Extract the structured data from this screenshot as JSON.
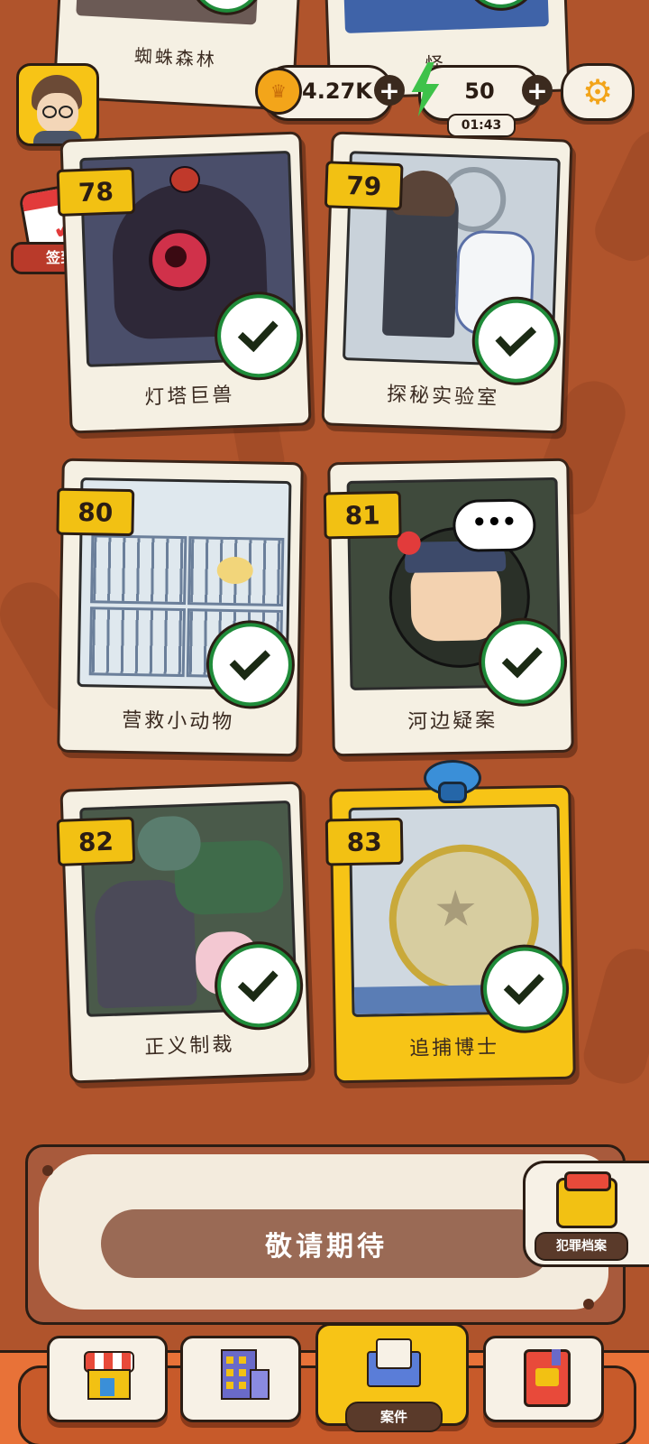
{
  "hud": {
    "coins": "4.27K",
    "energy": "50",
    "energy_timer": "01:43"
  },
  "checkin": {
    "label": "签到"
  },
  "top_cards": [
    {
      "name": "蜘蛛森林"
    },
    {
      "name": "怪..."
    }
  ],
  "cases": [
    {
      "number": "78",
      "name": "灯塔巨兽",
      "completed": true
    },
    {
      "number": "79",
      "name": "探秘实验室",
      "completed": true
    },
    {
      "number": "80",
      "name": "营救小动物",
      "completed": true
    },
    {
      "number": "81",
      "name": "河边疑案",
      "completed": true
    },
    {
      "number": "82",
      "name": "正义制裁",
      "completed": true
    },
    {
      "number": "83",
      "name": "追捕博士",
      "completed": true,
      "selected": true
    }
  ],
  "banner": {
    "text": "敬请期待"
  },
  "archive": {
    "label": "犯罪档案"
  },
  "nav": {
    "active_label": "案件",
    "items": [
      "shop-icon",
      "city-icon",
      "case-envelope-icon",
      "notebook-icon"
    ]
  },
  "colors": {
    "background": "#b0542c",
    "card_highlight": "#f7c416",
    "check_green": "#1f8c3a",
    "badge_yellow": "#f2c113"
  }
}
